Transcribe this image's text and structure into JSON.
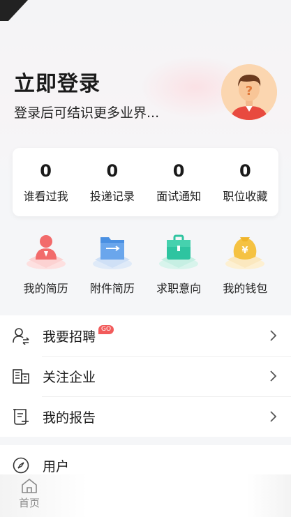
{
  "header": {
    "title": "立即登录",
    "subtitle": "登录后可结识更多业界..."
  },
  "stats": [
    {
      "value": "0",
      "label": "谁看过我"
    },
    {
      "value": "0",
      "label": "投递记录"
    },
    {
      "value": "0",
      "label": "面试通知"
    },
    {
      "value": "0",
      "label": "职位收藏"
    }
  ],
  "quick_actions": [
    {
      "label": "我的简历",
      "icon": "resume-icon",
      "color": "#f26b6b"
    },
    {
      "label": "附件简历",
      "icon": "folder-icon",
      "color": "#4a90e2"
    },
    {
      "label": "求职意向",
      "icon": "briefcase-icon",
      "color": "#2ec4a0"
    },
    {
      "label": "我的钱包",
      "icon": "wallet-icon",
      "color": "#f5c242"
    }
  ],
  "menu": [
    {
      "label": "我要招聘",
      "icon": "recruit-icon",
      "badge": "GO"
    },
    {
      "label": "关注企业",
      "icon": "company-icon"
    },
    {
      "label": "我的报告",
      "icon": "report-icon"
    }
  ],
  "menu2": {
    "label": "用户",
    "icon": "compass-icon"
  },
  "tabbar": {
    "home_label": "首页"
  }
}
